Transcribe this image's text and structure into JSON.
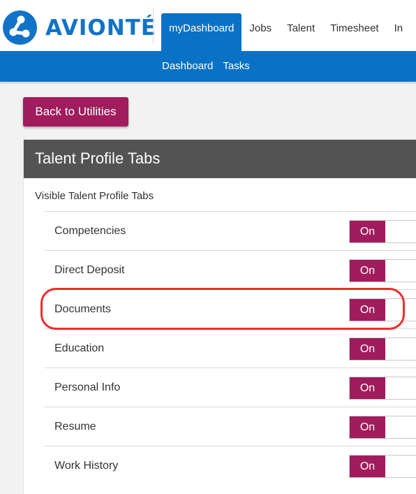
{
  "app": {
    "brand": "AVIONTÉ"
  },
  "nav": {
    "tabs": [
      {
        "label": "myDashboard",
        "active": true
      },
      {
        "label": "Jobs",
        "active": false
      },
      {
        "label": "Talent",
        "active": false
      },
      {
        "label": "Timesheet",
        "active": false
      },
      {
        "label": "In",
        "active": false
      }
    ]
  },
  "subnav": {
    "items": [
      "Dashboard",
      "Tasks"
    ]
  },
  "back_button": {
    "label": "Back to Utilities"
  },
  "panel": {
    "title": "Talent Profile Tabs",
    "section_label": "Visible Talent Profile Tabs",
    "tabs": [
      {
        "label": "Competencies",
        "state": "On"
      },
      {
        "label": "Direct Deposit",
        "state": "On"
      },
      {
        "label": "Documents",
        "state": "On",
        "highlighted": true
      },
      {
        "label": "Education",
        "state": "On"
      },
      {
        "label": "Personal Info",
        "state": "On"
      },
      {
        "label": "Resume",
        "state": "On"
      },
      {
        "label": "Work History",
        "state": "On"
      }
    ]
  },
  "colors": {
    "brand_blue": "#0a72c4",
    "accent_magenta": "#a01c5c",
    "header_gray": "#535353",
    "highlight_red": "#ef2b2b"
  },
  "icons": {
    "logo": "avionte-logo-icon"
  }
}
